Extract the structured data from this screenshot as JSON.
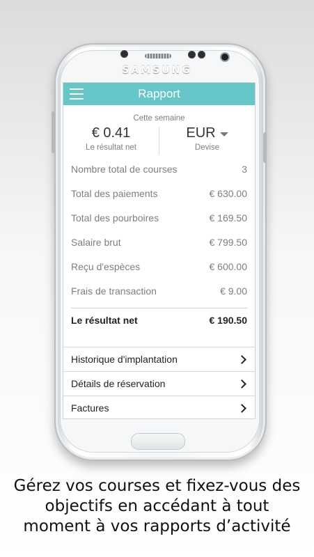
{
  "device": {
    "brand": "SAMSUNG"
  },
  "app": {
    "title": "Rapport",
    "period": "Cette semaine",
    "net_value": "€ 0.41",
    "net_label": "Le résultat net",
    "currency_value": "EUR",
    "currency_label": "Devise"
  },
  "report_rows": [
    {
      "label": "Nombre total de courses",
      "value": "3"
    },
    {
      "label": "Total des paiements",
      "value": "€ 630.00"
    },
    {
      "label": "Total des pourboires",
      "value": "€ 169.50"
    },
    {
      "label": "Salaire brut",
      "value": "€ 799.50"
    },
    {
      "label": "Reçu d'espèces",
      "value": "€ 600.00"
    },
    {
      "label": "Frais de transaction",
      "value": "€ 9.00"
    }
  ],
  "total_row": {
    "label": "Le résultat net",
    "value": "€ 190.50"
  },
  "links": [
    {
      "label": "Historique d'implantation"
    },
    {
      "label": "Détails de réservation"
    },
    {
      "label": "Factures"
    }
  ],
  "caption": {
    "line1": "Gérez vos courses et fixez-vous des",
    "line2": "objectifs en accédant à tout",
    "line3": "moment à vos rapports d’activité"
  },
  "colors": {
    "accent": "#67c6c8"
  }
}
